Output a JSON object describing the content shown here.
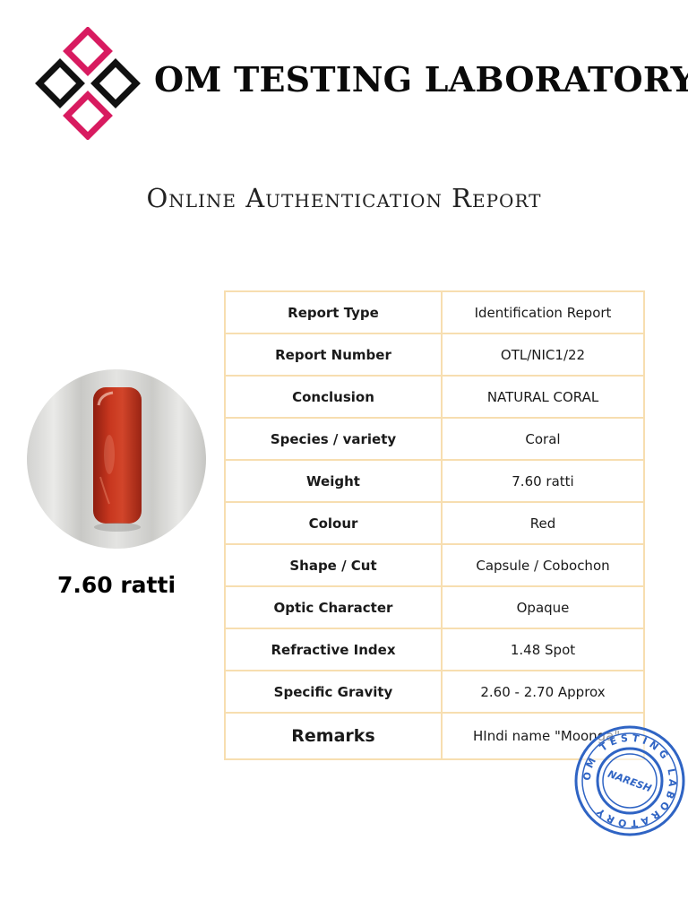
{
  "header": {
    "lab_name": "OM TESTING LABORATORY",
    "report_title": "Online Authentication Report"
  },
  "logo": {
    "icon": "diamond-cluster-logo",
    "colors": {
      "outline_dark": "#111111",
      "outline_accent": "#d81b60"
    }
  },
  "gem": {
    "icon": "red-coral-capsule-photo",
    "weight_label": "7.60 ratti",
    "color": "#c0301b"
  },
  "report": {
    "rows": [
      {
        "label": "Report Type",
        "value": "Identification Report"
      },
      {
        "label": "Report Number",
        "value": "OTL/NIC1/22"
      },
      {
        "label": "Conclusion",
        "value": "NATURAL CORAL"
      },
      {
        "label": "Species / variety",
        "value": "Coral"
      },
      {
        "label": "Weight",
        "value": "7.60 ratti"
      },
      {
        "label": "Colour",
        "value": "Red"
      },
      {
        "label": "Shape / Cut",
        "value": "Capsule / Cobochon"
      },
      {
        "label": "Optic Character",
        "value": "Opaque"
      },
      {
        "label": "Refractive Index",
        "value": "1.48 Spot"
      },
      {
        "label": "Specific Gravity",
        "value": "2.60 - 2.70 Approx"
      },
      {
        "label": "Remarks",
        "value": "HIndi name \"Moonga\""
      }
    ],
    "border_color": "#f7deb0"
  },
  "stamp": {
    "icon": "lab-seal-stamp",
    "ring_text": "OM TESTING LABORATORY",
    "center_text": "NARESH",
    "color": "#2f64c4"
  }
}
